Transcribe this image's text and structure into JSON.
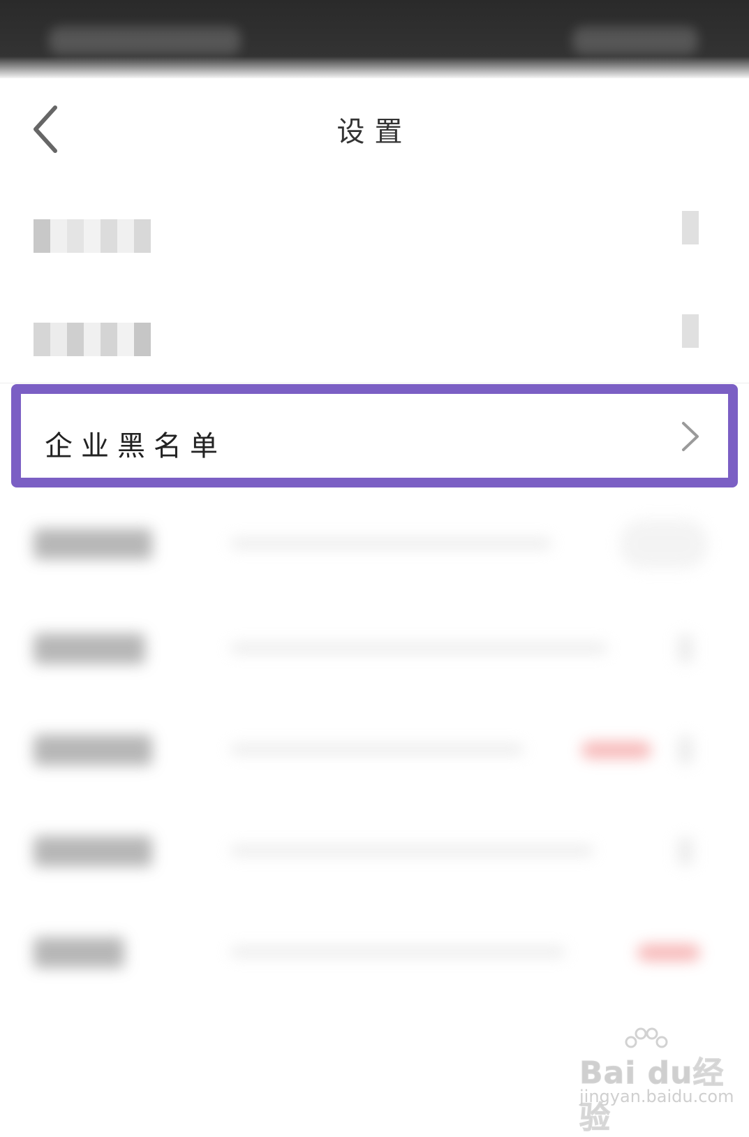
{
  "nav": {
    "title": "设置"
  },
  "highlighted_item": {
    "label": "企业黑名单"
  },
  "colors": {
    "highlight_border": "#7b5fc4",
    "status_bar": "#333333",
    "background": "#ffffff"
  },
  "icons": {
    "back": "chevron-left-icon",
    "item_arrow": "chevron-right-icon"
  },
  "watermark": {
    "brand": "Bai du经验",
    "url": "jingyan.baidu.com"
  }
}
